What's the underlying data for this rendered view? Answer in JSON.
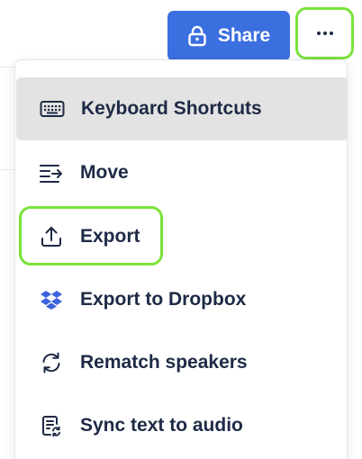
{
  "toolbar": {
    "share_label": "Share",
    "share_icon": "lock-icon",
    "more_icon": "more-horizontal-icon",
    "share_color": "#3b6fe0",
    "highlight_color": "#7be23a"
  },
  "menu": {
    "items": [
      {
        "label": "Keyboard Shortcuts",
        "icon": "keyboard-icon",
        "active": true
      },
      {
        "label": "Move",
        "icon": "move-icon",
        "active": false
      },
      {
        "label": "Export",
        "icon": "export-icon",
        "active": false,
        "highlighted": true
      },
      {
        "label": "Export to Dropbox",
        "icon": "dropbox-icon",
        "active": false
      },
      {
        "label": "Rematch speakers",
        "icon": "refresh-icon",
        "active": false
      },
      {
        "label": "Sync text to audio",
        "icon": "sync-document-icon",
        "active": false
      }
    ]
  }
}
